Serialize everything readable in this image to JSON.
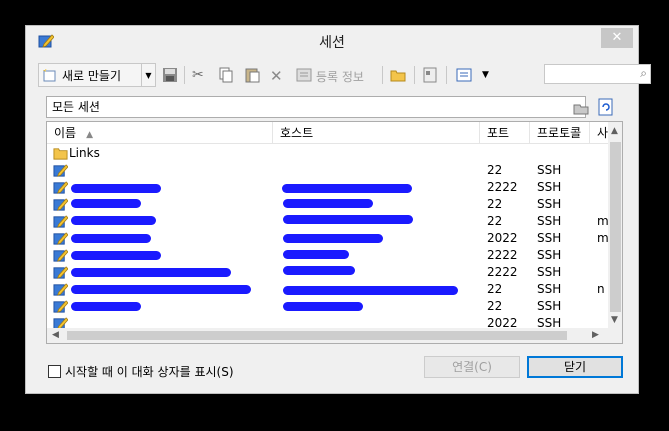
{
  "window": {
    "title": "세션"
  },
  "toolbar": {
    "new_label": "새로 만들기",
    "register_label": "등록 정보"
  },
  "pathbar": {
    "label": "모든 세션"
  },
  "columns": [
    "이름",
    "호스트",
    "포트",
    "프로토콜",
    "사"
  ],
  "rows": [
    {
      "name": "Links",
      "host": "",
      "port": "",
      "protocol": "",
      "extra": "",
      "folder": true
    },
    {
      "name": "",
      "host": "",
      "port": "22",
      "protocol": "SSH",
      "extra": ""
    },
    {
      "name": "",
      "host": "",
      "port": "2222",
      "protocol": "SSH",
      "extra": ""
    },
    {
      "name": "",
      "host": "",
      "port": "22",
      "protocol": "SSH",
      "extra": ""
    },
    {
      "name": "",
      "host": "",
      "port": "22",
      "protocol": "SSH",
      "extra": "m"
    },
    {
      "name": "",
      "host": "",
      "port": "2022",
      "protocol": "SSH",
      "extra": "m"
    },
    {
      "name": "",
      "host": "",
      "port": "2222",
      "protocol": "SSH",
      "extra": ""
    },
    {
      "name": "",
      "host": "",
      "port": "2222",
      "protocol": "SSH",
      "extra": ""
    },
    {
      "name": "",
      "host": "",
      "port": "22",
      "protocol": "SSH",
      "extra": "n"
    },
    {
      "name": "",
      "host": "",
      "port": "22",
      "protocol": "SSH",
      "extra": ""
    },
    {
      "name": "",
      "host": "",
      "port": "2022",
      "protocol": "SSH",
      "extra": ""
    }
  ],
  "footer": {
    "startup_checkbox_label": "시작할 때 이 대화 상자를 표시(S)",
    "connect_label": "연결(C)",
    "close_label": "닫기"
  },
  "icons": {
    "app": "session-pencil-icon",
    "folder": "folder-icon",
    "session": "session-icon"
  }
}
